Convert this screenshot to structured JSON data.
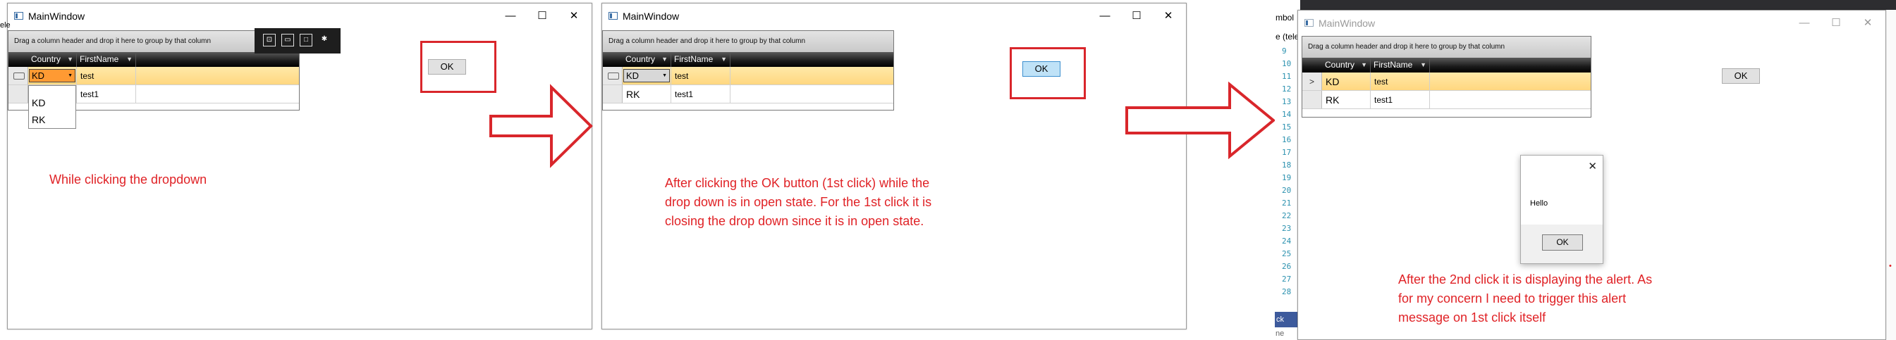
{
  "window": {
    "title": "MainWindow",
    "minimize_glyph": "—",
    "maximize_glyph": "☐",
    "close_glyph": "✕"
  },
  "grid": {
    "group_panel_text": "Drag a column header and drop it here to group by that column",
    "columns": [
      "Country",
      "FirstName"
    ],
    "rows": [
      {
        "country": "KD",
        "first_name": "test"
      },
      {
        "country": "RK",
        "first_name": "test1"
      }
    ],
    "filter_glyph": "▼"
  },
  "dropdown": {
    "options": [
      "KD",
      "RK"
    ]
  },
  "ok_button": {
    "label": "OK"
  },
  "row_indicator_glyph": ">",
  "annotations": {
    "panel1": "While clicking the dropdown",
    "panel2": [
      "After clicking the OK button (1st click) while the",
      "drop down is in open state. For the 1st click it is",
      "closing the drop down since it is in open state."
    ],
    "panel3": [
      "After the 2nd click it is displaying the alert. As",
      "for my concern I need to trigger this alert",
      "message on 1st click itself"
    ]
  },
  "alert": {
    "message": "Hello",
    "ok_label": "OK",
    "close_glyph": "✕"
  },
  "ide": {
    "line_numbers": [
      "9",
      "10",
      "11",
      "12",
      "13",
      "14",
      "15",
      "16",
      "17",
      "18",
      "19",
      "20",
      "21",
      "22",
      "23",
      "24",
      "25",
      "26",
      "27",
      "28"
    ],
    "fragment_top": "mbol",
    "fragment_tab": "e (tele",
    "fragment_bottom": "ck",
    "fragment_bottom2": "ne",
    "edge_left": "ele"
  },
  "colors": {
    "annotation_red": "#e02226",
    "selected_row": "#ffd780",
    "header_dark": "#000000",
    "ok_hover": "#bfe2f7",
    "editor_active": "#ff9a33"
  }
}
